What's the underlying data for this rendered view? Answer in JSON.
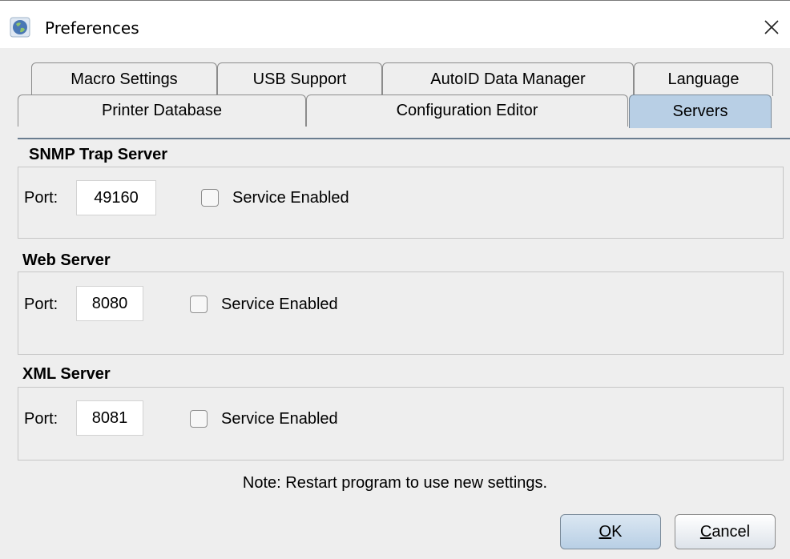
{
  "window": {
    "title": "Preferences",
    "app_icon": "globe-icon",
    "close_icon": "close-icon"
  },
  "tabs": {
    "row1": [
      {
        "label": "Macro Settings"
      },
      {
        "label": "USB Support"
      },
      {
        "label": "AutoID Data Manager"
      },
      {
        "label": "Language"
      }
    ],
    "row2": [
      {
        "label": "Printer Database"
      },
      {
        "label": "Configuration Editor"
      },
      {
        "label": "Servers",
        "selected": true
      }
    ]
  },
  "sections": [
    {
      "title": "SNMP Trap Server",
      "port_label": "Port:",
      "port_value": "49160",
      "enabled_label": "Service Enabled",
      "enabled": false
    },
    {
      "title": "Web Server",
      "port_label": "Port:",
      "port_value": "8080",
      "enabled_label": "Service Enabled",
      "enabled": false
    },
    {
      "title": "XML Server",
      "port_label": "Port:",
      "port_value": "8081",
      "enabled_label": "Service Enabled",
      "enabled": false
    }
  ],
  "note": "Note: Restart program to use new settings.",
  "buttons": {
    "ok_mnemonic": "O",
    "ok_rest": "K",
    "cancel_mnemonic": "C",
    "cancel_rest": "ancel"
  },
  "colors": {
    "selected_tab": "#b8cfe5",
    "client_bg": "#eeeeee"
  }
}
